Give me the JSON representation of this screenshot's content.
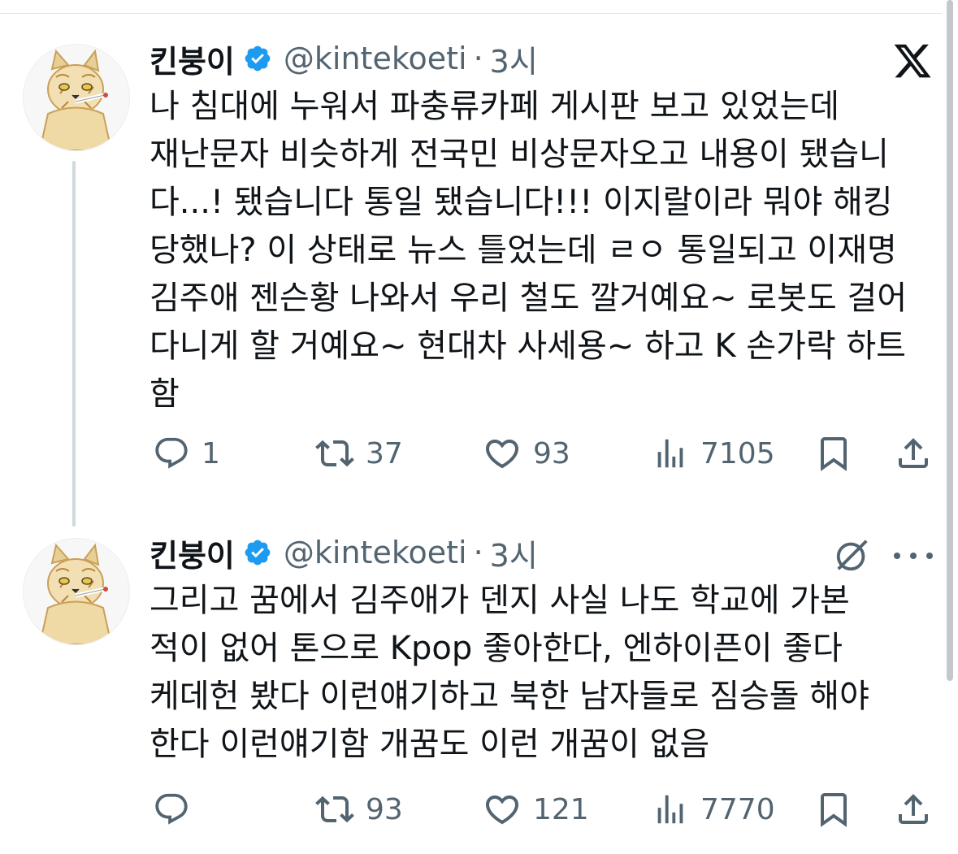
{
  "tweets": [
    {
      "author": {
        "name": "킨붕이",
        "handle": "@kintekoeti",
        "time": "3시",
        "verified": true,
        "avatar": "cat-avatar"
      },
      "text": "나 침대에 누워서 파충류카페 게시판 보고 있었는데\n재난문자 비슷하게 전국민 비상문자오고 내용이 됐습니\n다...! 됐습니다 통일 됐습니다!!! 이지랄이라 뭐야 해킹\n당했나? 이 상태로 뉴스 틀었는데 ㄹㅇ 통일되고 이재명\n김주애 젠슨황 나와서 우리 철도 깔거예요~ 로봇도 걸어\n다니게 할 거예요~ 현대차 사세용~ 하고 K 손가락 하트\n함",
      "stats": {
        "replies": "1",
        "reposts": "37",
        "likes": "93",
        "views": "7105"
      }
    },
    {
      "author": {
        "name": "킨붕이",
        "handle": "@kintekoeti",
        "time": "3시",
        "verified": true,
        "avatar": "cat-avatar"
      },
      "text": "그리고 꿈에서 김주애가 덴지 사실 나도 학교에 가본\n적이 없어 톤으로 Kpop 좋아한다, 엔하이픈이 좋다\n케데헌 봤다 이런얘기하고 북한 남자들로 짐승돌 해야\n한다 이런얘기함 개꿈도 이런 개꿈이 없음",
      "stats": {
        "replies": "",
        "reposts": "93",
        "likes": "121",
        "views": "7770"
      }
    }
  ],
  "icons": {
    "brand": "x-logo-icon",
    "grok": "grok-icon",
    "more": "more-icon",
    "reply": "reply-icon",
    "repost": "repost-icon",
    "like": "heart-icon",
    "views": "views-icon",
    "bookmark": "bookmark-icon",
    "share": "share-icon",
    "verified": "verified-badge-icon"
  },
  "colors": {
    "text": "#0f1419",
    "secondary": "#536471",
    "verified": "#1d9bf0",
    "thread_line": "#cfd9de"
  }
}
